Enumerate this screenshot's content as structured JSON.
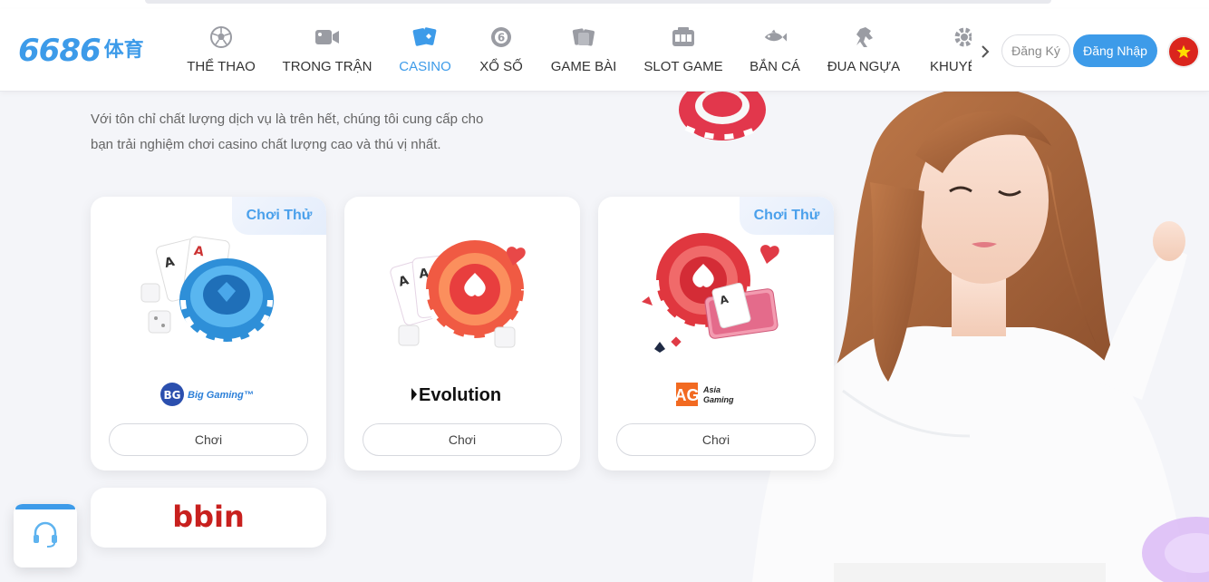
{
  "logo": {
    "number": "6686",
    "cn": "体育"
  },
  "nav": {
    "items": [
      {
        "label": "THỂ THAO",
        "icon": "soccer-ball-icon"
      },
      {
        "label": "TRONG TRẬN",
        "icon": "video-camera-icon"
      },
      {
        "label": "CASINO",
        "icon": "playing-cards-icon",
        "active": true
      },
      {
        "label": "XỔ SỐ",
        "icon": "lottery-ball-icon"
      },
      {
        "label": "GAME BÀI",
        "icon": "card-game-icon"
      },
      {
        "label": "SLOT GAME",
        "icon": "slot-machine-icon"
      },
      {
        "label": "BẮN CÁ",
        "icon": "fish-icon"
      },
      {
        "label": "ĐUA NGỰA",
        "icon": "horse-icon"
      },
      {
        "label": "KHUYẾ",
        "icon": "gear-icon"
      }
    ],
    "next_icon": "chevron-right-icon"
  },
  "auth": {
    "register_label": "Đăng Ký",
    "login_label": "Đăng Nhập"
  },
  "language": {
    "flag": "vietnam-flag-icon"
  },
  "intro": {
    "line1": "Với tôn chỉ chất lượng dịch vụ là trên hết, chúng tôi cung cấp cho",
    "line2": "bạn trải nghiệm chơi casino chất lượng cao và thú vị nhất."
  },
  "cards": [
    {
      "provider": "Big Gaming",
      "badge": "Chơi Thử",
      "play_label": "Chơi",
      "logo_text": "BG",
      "logo_sub": "Big Gaming™"
    },
    {
      "provider": "Evolution",
      "badge": "",
      "play_label": "Chơi",
      "logo_text": "Evolution"
    },
    {
      "provider": "Asia Gaming",
      "badge": "Chơi Thử",
      "play_label": "Chơi",
      "logo_text": "AG",
      "logo_sub1": "Asia",
      "logo_sub2": "Gaming"
    }
  ],
  "bbin": {
    "logo_text": "bbin"
  },
  "colors": {
    "accent": "#3d9be9",
    "red": "#e5354a",
    "background": "#f4f5f9"
  }
}
